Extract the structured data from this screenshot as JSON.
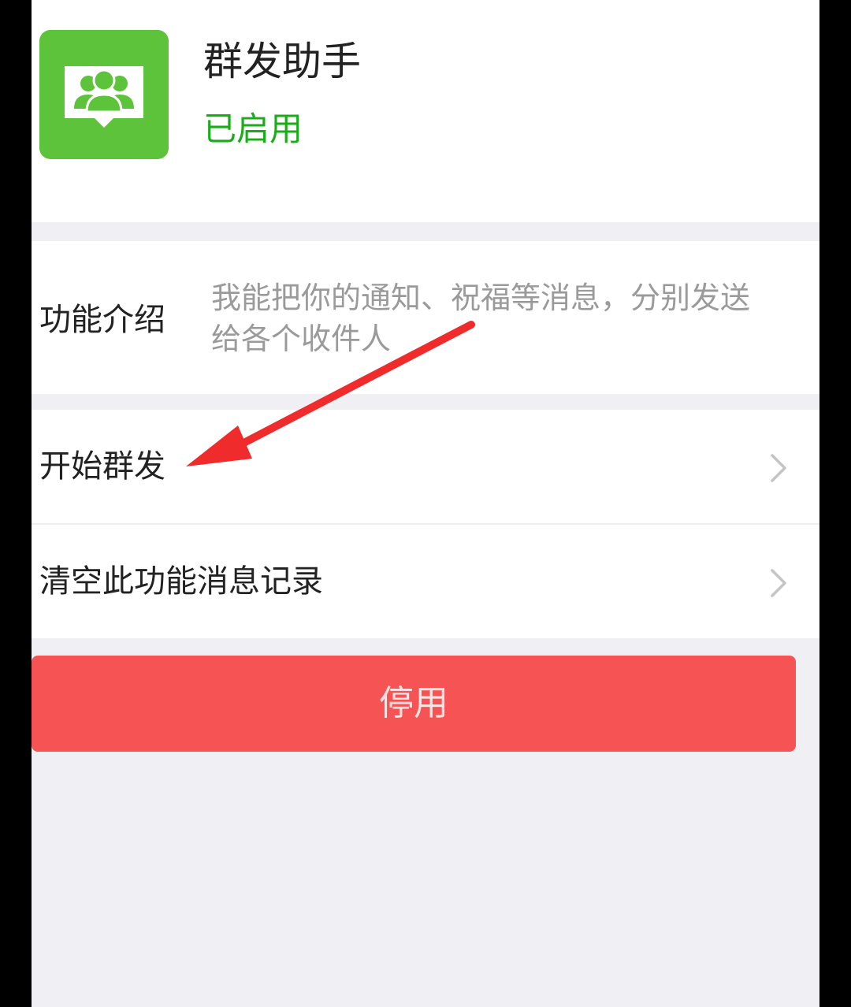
{
  "app": {
    "icon": "group-chat-icon",
    "title": "群发助手",
    "status": "已启用"
  },
  "description": {
    "label": "功能介绍",
    "text": "我能把你的通知、祝福等消息，分别发送给各个收件人"
  },
  "menu": {
    "items": [
      {
        "label": "开始群发",
        "icon": "chevron-right-icon"
      },
      {
        "label": "清空此功能消息记录",
        "icon": "chevron-right-icon"
      }
    ]
  },
  "actions": {
    "disable_label": "停用"
  },
  "annotation": {
    "icon": "red-arrow-annotation"
  },
  "colors": {
    "brand_green": "#5cc33a",
    "status_green": "#1aad19",
    "danger_red": "#f65454",
    "arrow_red": "#ef2b2b",
    "background": "#efeff4"
  }
}
